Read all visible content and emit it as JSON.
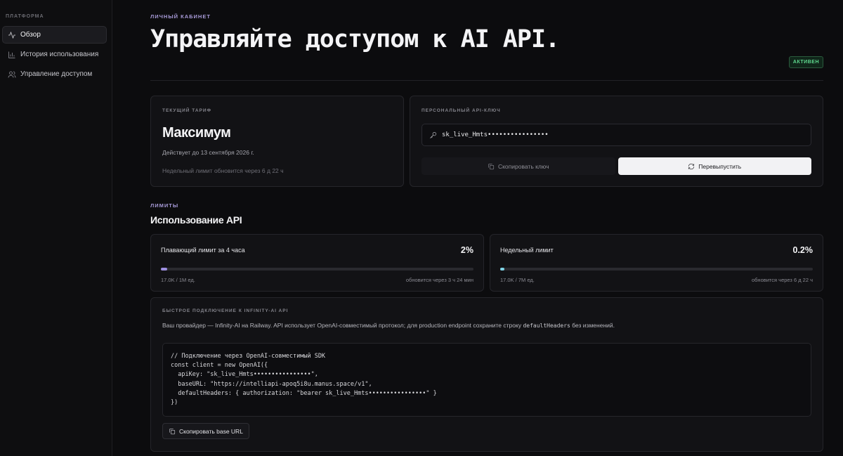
{
  "sidebar": {
    "section": "ПЛАТФОРМА",
    "items": [
      {
        "label": "Обзор",
        "icon": "activity-icon",
        "active": true
      },
      {
        "label": "История использования",
        "icon": "bar-chart-icon",
        "active": false
      },
      {
        "label": "Управление доступом",
        "icon": "users-icon",
        "active": false
      }
    ]
  },
  "header": {
    "eyebrow": "ЛИЧНЫЙ КАБИНЕТ",
    "title": "Управляйте доступом к AI API.",
    "status_badge": "АКТИВЕН"
  },
  "plan": {
    "label": "ТЕКУЩИЙ ТАРИФ",
    "name": "Максимум",
    "valid_until": "Действует до 13 сентября 2026 г.",
    "weekly_reset": "Недельный лимит обновится через 6 д 22 ч"
  },
  "api_key": {
    "label": "ПЕРСОНАЛЬНЫЙ API-КЛЮЧ",
    "value": "sk_live_Hmts••••••••••••••••",
    "copy_label": "Скопировать ключ",
    "reissue_label": "Перевыпустить"
  },
  "limits": {
    "eyebrow": "ЛИМИТЫ",
    "title": "Использование API",
    "cards": [
      {
        "name": "Плавающий лимит за 4 часа",
        "percent_text": "2%",
        "fraction": 0.02,
        "usage": "17.0K / 1M ед.",
        "reset": "обновится через 3 ч 24 мин",
        "bar_color": "#9d8fe0"
      },
      {
        "name": "Недельный лимит",
        "percent_text": "0.2%",
        "fraction": 0.002,
        "usage": "17.0K / 7M ед.",
        "reset": "обновится через 6 д 22 ч",
        "bar_color": "#7fd3e6"
      }
    ]
  },
  "connect": {
    "label": "БЫСТРОЕ ПОДКЛЮЧЕНИЕ К INFINITY-AI API",
    "desc_prefix": "Ваш провайдер — Infinity-AI на Railway. API использует OpenAI-совместимый протокол; для production endpoint сохраните строку ",
    "desc_code": "defaultHeaders",
    "desc_suffix": " без изменений.",
    "code_lines": [
      "// Подключение через OpenAI-совместимый SDK",
      "const client = new OpenAI({",
      "  apiKey: \"sk_live_Hmts••••••••••••••••\",",
      "  baseURL: \"https://intelliapi-apoq5i8u.manus.space/v1\",",
      "  defaultHeaders: { authorization: \"bearer sk_live_Hmts••••••••••••••••\" }",
      "})"
    ],
    "copy_base_url_label": "Скопировать base URL"
  },
  "colors": {
    "accent": "#a89bd8",
    "status_green": "#5fd88e"
  }
}
